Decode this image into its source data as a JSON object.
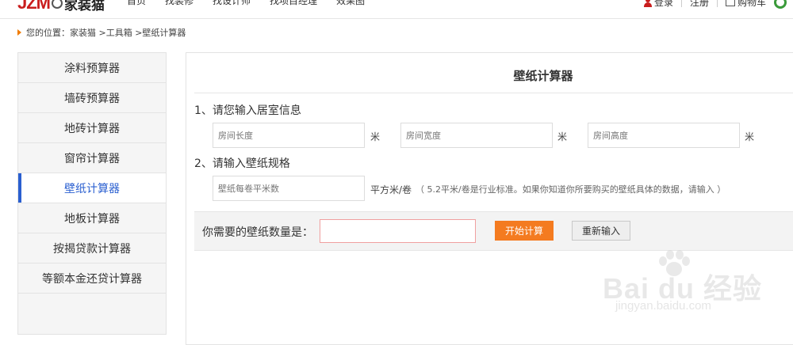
{
  "header": {
    "logo_mark": "JZM",
    "logo_text": "家装猫",
    "nav": [
      "首页",
      "找装修",
      "找设计师",
      "找项目经理",
      "效果图"
    ],
    "login": "登录",
    "register": "注册",
    "cart": "购物车"
  },
  "breadcrumb": "您的位置：家装猫 >工具箱 >壁纸计算器",
  "sidebar": {
    "items": [
      {
        "label": "涂料预算器"
      },
      {
        "label": "墙砖预算器"
      },
      {
        "label": "地砖计算器"
      },
      {
        "label": "窗帘计算器"
      },
      {
        "label": "壁纸计算器",
        "active": true
      },
      {
        "label": "地板计算器"
      },
      {
        "label": "按揭贷款计算器"
      },
      {
        "label": "等额本金还贷计算器"
      }
    ]
  },
  "main": {
    "title": "壁纸计算器",
    "section1": "1、请您输入居室信息",
    "length_placeholder": "房间长度",
    "width_placeholder": "房间宽度",
    "height_placeholder": "房间高度",
    "unit_m": "米",
    "section2": "2、请输入壁纸规格",
    "roll_placeholder": "壁纸每卷平米数",
    "unit_roll": "平方米/卷",
    "hint": "（ 5.2平米/卷是行业标准。如果你知道你所要购买的壁纸具体的数据，请输入 ）",
    "result_label": "你需要的壁纸数量是：",
    "result_value": "",
    "calc_button": "开始计算",
    "reset_button": "重新输入"
  },
  "watermark": {
    "main": "Bai du 经验",
    "sub": "jingyan.baidu.com"
  },
  "colors": {
    "accent": "#2a5fd0",
    "brand_red": "#c91d1d",
    "calc_orange": "#f47b20"
  }
}
